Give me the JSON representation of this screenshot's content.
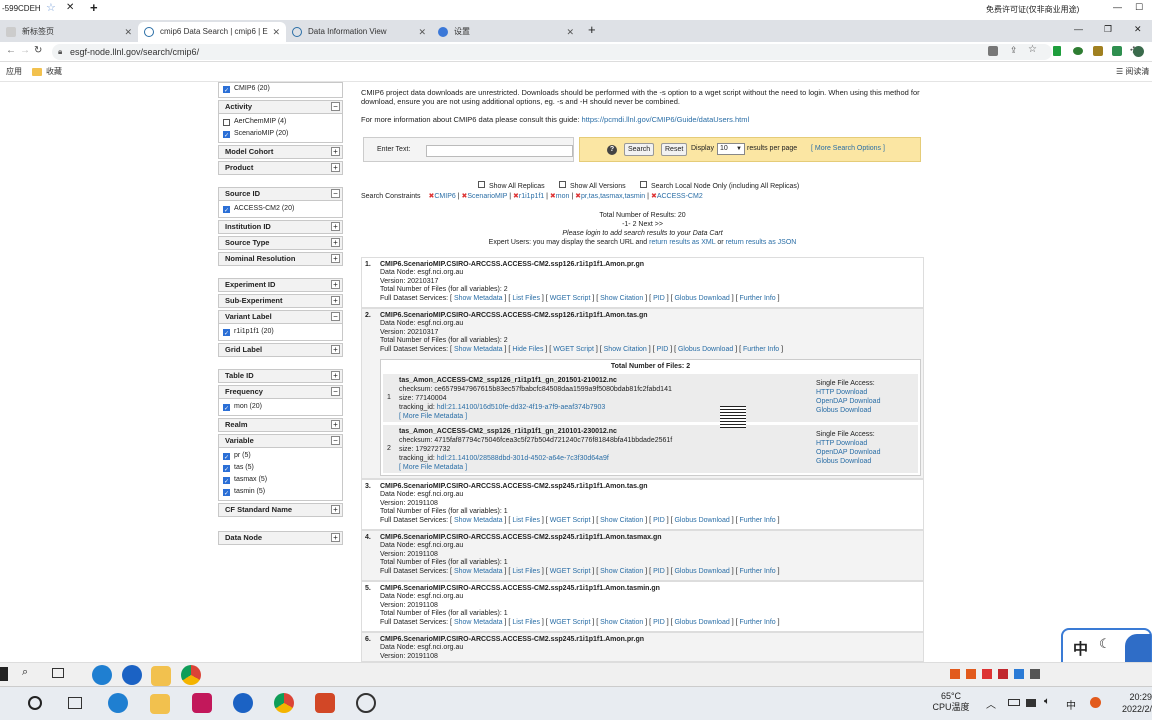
{
  "window": {
    "title_left": "-599CDEH",
    "title_right": "免费许可证(仅非商业用途)",
    "controls": [
      "—",
      "☐",
      "✕"
    ]
  },
  "tabs": [
    {
      "label": "新标签页"
    },
    {
      "label": "cmip6 Data Search | cmip6 | E"
    },
    {
      "label": "Data Information View"
    },
    {
      "label": "设置"
    }
  ],
  "address": {
    "url": "esgf-node.llnl.gov/search/cmip6/"
  },
  "bookmarks": {
    "apps": "应用",
    "fav": "收藏",
    "reading": "阅读清"
  },
  "facets": {
    "mip_era_item": "CMIP6 (20)",
    "activity": {
      "label": "Activity",
      "items": [
        "AerChemMIP (4)",
        "ScenarioMIP (20)"
      ]
    },
    "model_cohort": "Model Cohort",
    "product": "Product",
    "source_id": {
      "label": "Source ID",
      "items": [
        "ACCESS-CM2 (20)"
      ]
    },
    "institution_id": "Institution ID",
    "source_type": "Source Type",
    "nominal_resolution": "Nominal Resolution",
    "experiment_id": "Experiment ID",
    "sub_experiment": "Sub-Experiment",
    "variant_label": {
      "label": "Variant Label",
      "items": [
        "r1i1p1f1 (20)"
      ]
    },
    "grid_label": "Grid Label",
    "table_id": "Table ID",
    "frequency": {
      "label": "Frequency",
      "items": [
        "mon (20)"
      ]
    },
    "realm": "Realm",
    "variable": {
      "label": "Variable",
      "items": [
        "pr (5)",
        "tas (5)",
        "tasmax (5)",
        "tasmin (5)"
      ]
    },
    "cf_standard_name": "CF Standard Name",
    "data_node": "Data Node"
  },
  "main": {
    "info1": "CMIP6 project data downloads are unrestricted. Downloads should be performed with the -s option to a wget script without the need to login. When using this method for download, ensure you are not using additional options, eg. -s and -H should never be combined.",
    "info2_prefix": "For more information about CMIP6 data please consult this guide:",
    "info2_link": "https://pcmdi.llnl.gov/CMIP6/Guide/dataUsers.html",
    "enter_text": "Enter Text:",
    "search_btn": "Search",
    "reset_btn": "Reset",
    "display": "Display",
    "per_page_value": "10",
    "per_page_suffix": "results per page",
    "more_options": "[ More Search Options ]",
    "show_all_replicas": "Show All Replicas",
    "show_all_versions": "Show All Versions",
    "local_node": "Search Local Node Only (including All Replicas)",
    "constraints_label": "Search Constraints",
    "constraints": [
      "CMIP6",
      "ScenarioMIP",
      "r1i1p1f1",
      "mon",
      "pr,tas,tasmax,tasmin",
      "ACCESS-CM2"
    ],
    "total": "Total Number of Results: 20",
    "pager": "-1- 2 Next >>",
    "login_note": "Please login to add search results to your Data Cart",
    "expert_prefix": "Expert Users: you may display the search URL and",
    "expert_xml": "return results as XML",
    "expert_or": "or",
    "expert_json": "return results as JSON"
  },
  "services": [
    "Show Metadata",
    "List Files",
    "WGET Script",
    "Show Citation",
    "PID",
    "Globus Download",
    "Further Info"
  ],
  "services_open": [
    "Show Metadata",
    "Hide Files",
    "WGET Script",
    "Show Citation",
    "PID",
    "Globus Download",
    "Further Info"
  ],
  "results": [
    {
      "num": "1.",
      "title": "CMIP6.ScenarioMIP.CSIRO-ARCCSS.ACCESS-CM2.ssp126.r1i1p1f1.Amon.pr.gn",
      "node": "Data Node: esgf.nci.org.au",
      "version": "Version: 20210317",
      "files": "Total Number of Files (for all variables): 2"
    },
    {
      "num": "2.",
      "title": "CMIP6.ScenarioMIP.CSIRO-ARCCSS.ACCESS-CM2.ssp126.r1i1p1f1.Amon.tas.gn",
      "node": "Data Node: esgf.nci.org.au",
      "version": "Version: 20210317",
      "files": "Total Number of Files (for all variables): 2"
    },
    {
      "num": "3.",
      "title": "CMIP6.ScenarioMIP.CSIRO-ARCCSS.ACCESS-CM2.ssp245.r1i1p1f1.Amon.tas.gn",
      "node": "Data Node: esgf.nci.org.au",
      "version": "Version: 20191108",
      "files": "Total Number of Files (for all variables): 1"
    },
    {
      "num": "4.",
      "title": "CMIP6.ScenarioMIP.CSIRO-ARCCSS.ACCESS-CM2.ssp245.r1i1p1f1.Amon.tasmax.gn",
      "node": "Data Node: esgf.nci.org.au",
      "version": "Version: 20191108",
      "files": "Total Number of Files (for all variables): 1"
    },
    {
      "num": "5.",
      "title": "CMIP6.ScenarioMIP.CSIRO-ARCCSS.ACCESS-CM2.ssp245.r1i1p1f1.Amon.tasmin.gn",
      "node": "Data Node: esgf.nci.org.au",
      "version": "Version: 20191108",
      "files": "Total Number of Files (for all variables): 1"
    },
    {
      "num": "6.",
      "title": "CMIP6.ScenarioMIP.CSIRO-ARCCSS.ACCESS-CM2.ssp245.r1i1p1f1.Amon.pr.gn",
      "node": "Data Node: esgf.nci.org.au",
      "version": "Version: 20191108"
    }
  ],
  "full_services_label": "Full Dataset Services:",
  "files_panel": {
    "total": "Total Number of Files: 2",
    "single_label": "Single File Access:",
    "links": [
      "HTTP Download",
      "OpenDAP Download",
      "Globus Download"
    ],
    "more_meta": "[ More File Metadata ]",
    "files": [
      {
        "num": "1",
        "name": "tas_Amon_ACCESS-CM2_ssp126_r1i1p1f1_gn_201501-210012.nc",
        "checksum": "checksum: ce6579947967615b83ec57fbabcfc84508daa1599a9f5080bdab81fc2fabd141",
        "size": "size: 77140004",
        "tracking_prefix": "tracking_id:",
        "tracking": "hdl:21.14100/16d510fe-dd32-4f19-a7f9-aeaf374b7903"
      },
      {
        "num": "2",
        "name": "tas_Amon_ACCESS-CM2_ssp126_r1i1p1f1_gn_210101-230012.nc",
        "checksum": "checksum: 4715faf87794c75046fcea3c5f27b504d721240c776f81848bfa41bbdade2561f",
        "size": "size: 179272732",
        "tracking_prefix": "tracking_id:",
        "tracking": "hdl:21.14100/28588dbd-301d-4502-a64e-7c3f30d64a9f"
      }
    ]
  },
  "taskbar": {
    "temp": "65°C",
    "temp_label": "CPU温度",
    "time": "20:29",
    "date": "2022/2/",
    "ime": "中"
  }
}
